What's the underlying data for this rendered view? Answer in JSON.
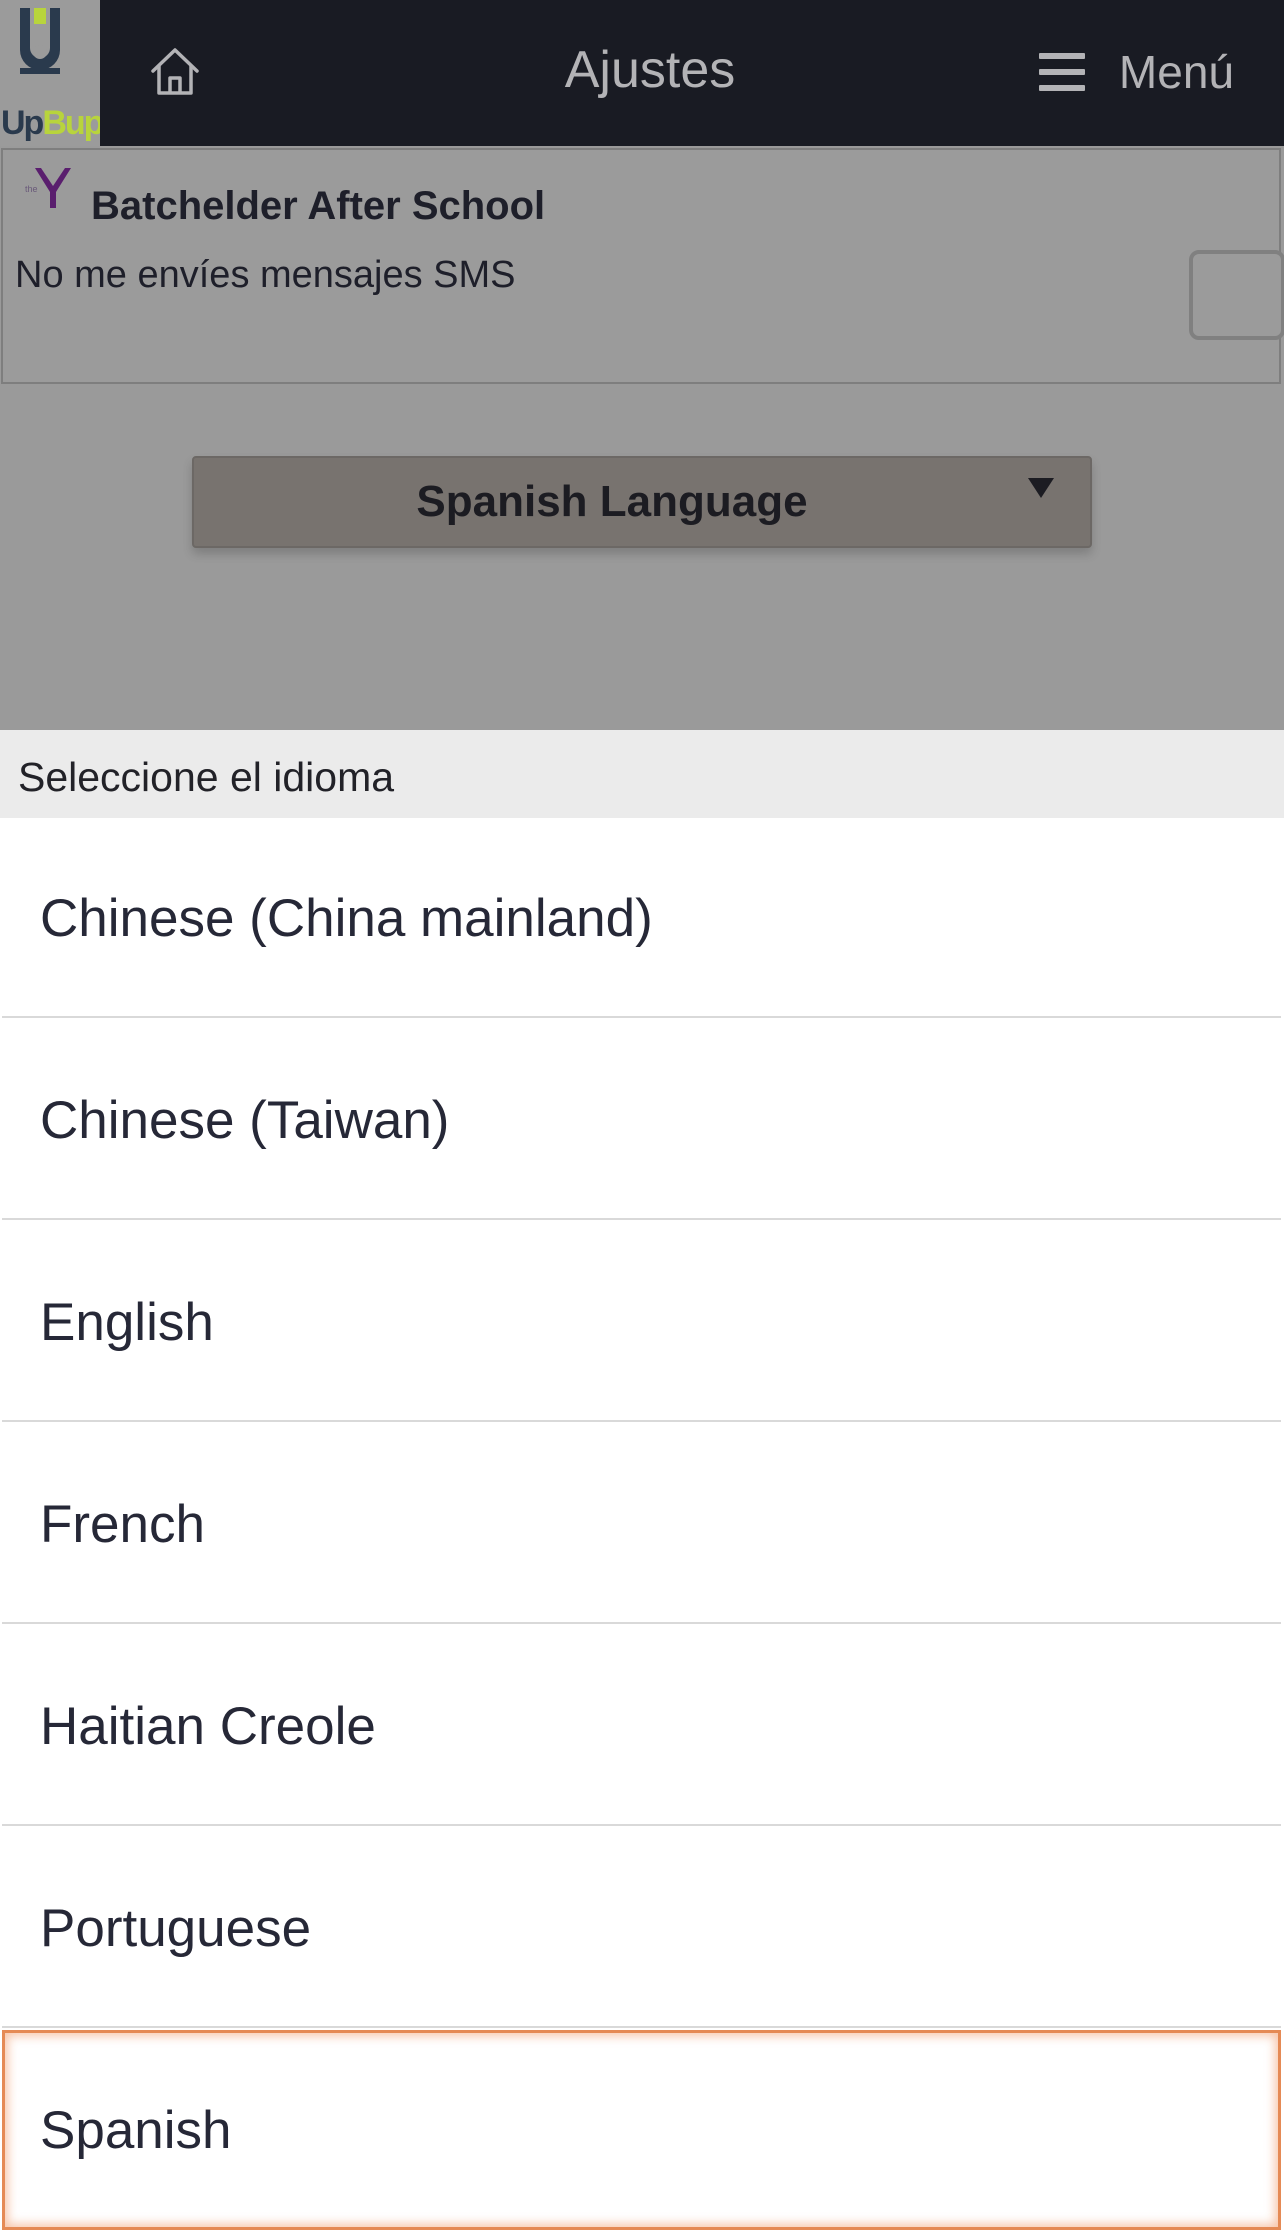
{
  "header": {
    "logo_text_up": "Up",
    "logo_text_bup": "Bup",
    "title": "Ajustes",
    "menu_label": "Menú"
  },
  "settings": {
    "org_name": "Batchelder After School",
    "sms_optout_label": "No me envíes mensajes SMS",
    "sms_optout_checked": false,
    "language_select_value": "Spanish Language"
  },
  "picker": {
    "title": "Seleccione el idioma",
    "options": [
      {
        "label": "Chinese (China mainland)",
        "selected": false
      },
      {
        "label": "Chinese (Taiwan)",
        "selected": false
      },
      {
        "label": "English",
        "selected": false
      },
      {
        "label": "French",
        "selected": false
      },
      {
        "label": "Haitian Creole",
        "selected": false
      },
      {
        "label": "Portuguese",
        "selected": false
      },
      {
        "label": "Spanish",
        "selected": true
      }
    ]
  },
  "colors": {
    "header_bg": "#191b23",
    "overlay_dim": "#9a9a9a",
    "selected_outline": "#e58a55",
    "logo_accent": "#b8d43c"
  }
}
